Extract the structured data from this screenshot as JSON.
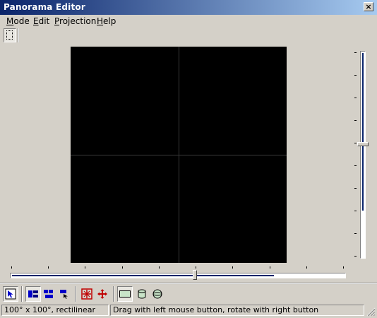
{
  "window": {
    "title": "Panorama Editor",
    "close_glyph": "×"
  },
  "menu": [
    {
      "mnemonic": "M",
      "rest": "ode"
    },
    {
      "mnemonic": "E",
      "rest": "dit"
    },
    {
      "mnemonic": "P",
      "rest": "rojection"
    },
    {
      "mnemonic": "H",
      "rest": "elp"
    }
  ],
  "toolbar": {
    "buttons": [
      {
        "icon": "select-arrow-icon",
        "pressed": true
      },
      {
        "icon": "view-layout-1-icon",
        "pressed": true
      },
      {
        "icon": "view-layout-2-icon",
        "pressed": false
      },
      {
        "icon": "view-layout-3-icon",
        "pressed": false
      },
      {
        "icon": "red-grid-icon",
        "pressed": false
      },
      {
        "icon": "red-move-icon",
        "pressed": false
      },
      {
        "icon": "rectilinear-projection-icon",
        "pressed": true
      },
      {
        "icon": "cylindrical-projection-icon",
        "pressed": false
      },
      {
        "icon": "spherical-projection-icon",
        "pressed": false
      }
    ]
  },
  "sliders": {
    "vertical": {
      "value_fraction": 0.55
    },
    "horizontal": {
      "value_fraction": 0.55
    }
  },
  "status": {
    "left": "100° x 100°, rectilinear",
    "right": "Drag with left mouse button, rotate with right button"
  },
  "colors": {
    "accent": "#0a246a",
    "titlebar_end": "#a6caf0",
    "face": "#d4d0c8"
  }
}
